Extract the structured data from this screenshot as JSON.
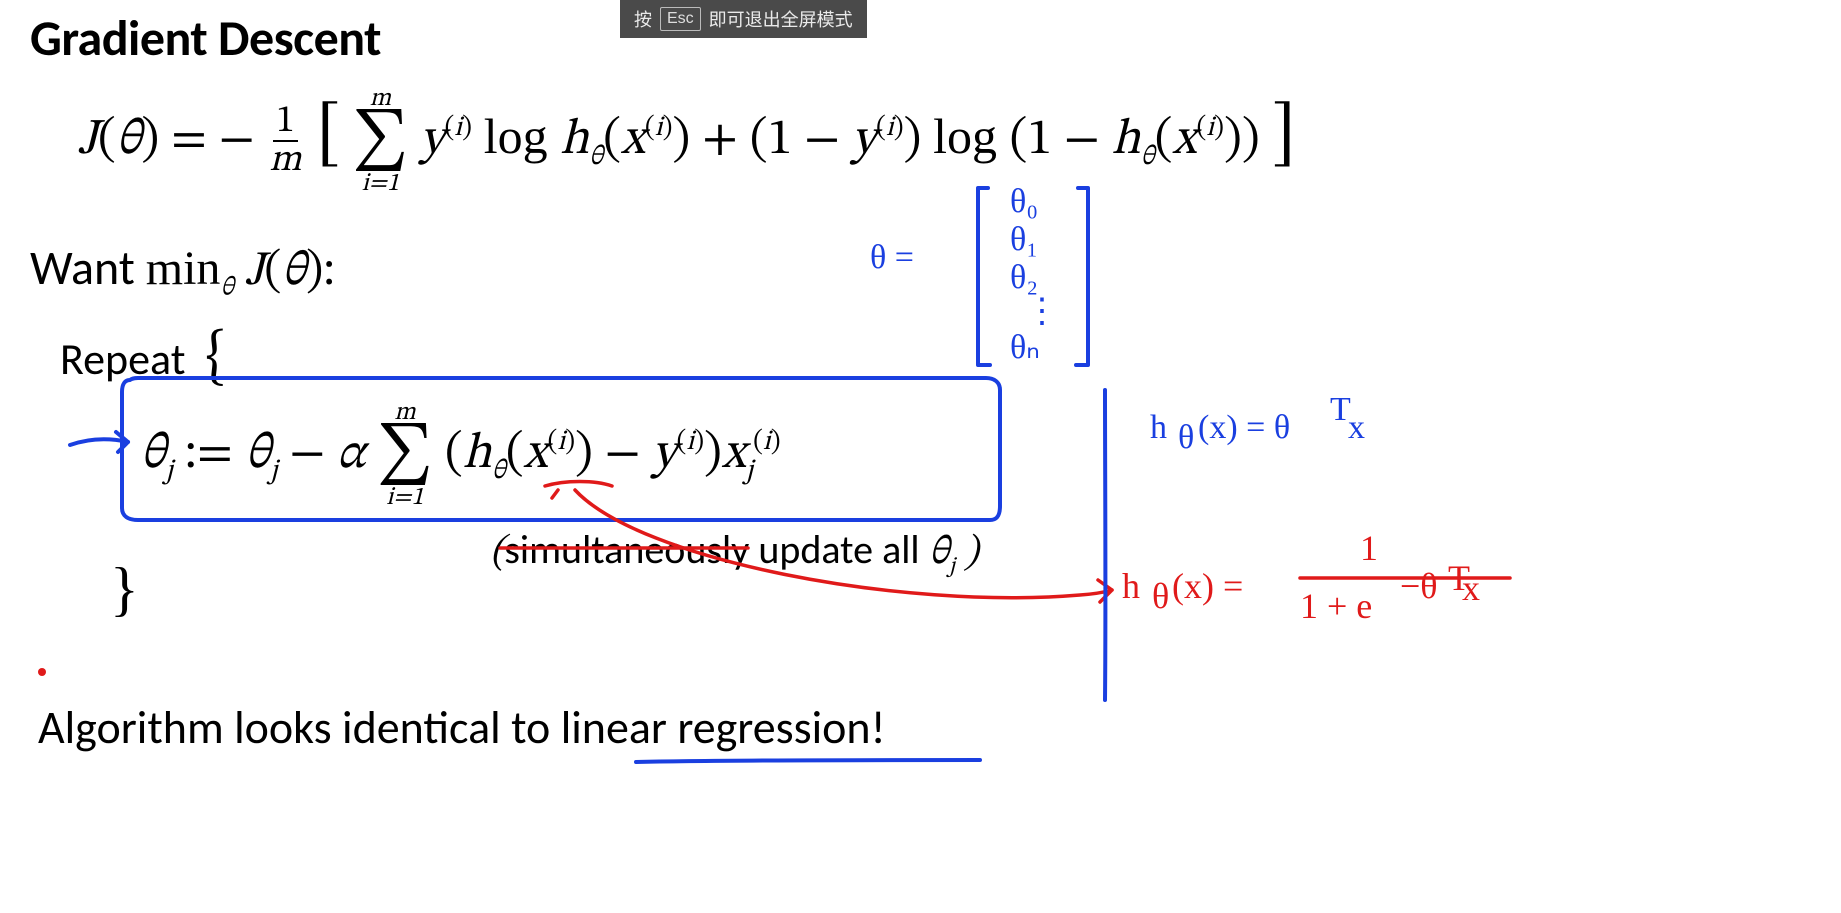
{
  "hint": {
    "prefix": "按",
    "key": "Esc",
    "suffix": "即可退出全屏模式"
  },
  "title": "Gradient Descent",
  "cost_eq": {
    "lead": "J(θ) = − ",
    "frac_num": "1",
    "frac_den": "m",
    "bracket_open": "[",
    "sum_top": "m",
    "sum_bottom": "i=1",
    "body": " y⁽ⁱ⁾ log h_θ(x⁽ⁱ⁾) + (1 − y⁽ⁱ⁾) log (1 − h_θ(x⁽ⁱ⁾))",
    "bracket_close": "]"
  },
  "want_line_prefix": "Want ",
  "want_line_math": "min_θ J(θ):",
  "repeat_text": "Repeat  {",
  "update_eq": {
    "left": "θ_j := θ_j − α ",
    "sum_top": "m",
    "sum_bottom": "i=1",
    "body": " (h_θ(x⁽ⁱ⁾) − y⁽ⁱ⁾) x_j⁽ⁱ⁾"
  },
  "sim_text": "(simultaneously update all θ_j )",
  "close_brace": "}",
  "alg_line": "Algorithm looks identical to linear regression!",
  "handwriting": {
    "theta_vec_label": "θ =",
    "theta_vec_items": [
      "θ₀",
      "θ₁",
      "θ₂",
      "⋮",
      "θₙ"
    ],
    "linear_h": "h_θ(x) = θᵀx",
    "logistic_h_left": "h_θ(x) =",
    "logistic_h_frac_num": "1",
    "logistic_h_frac_den": "1 + e^{−θᵀx}"
  }
}
